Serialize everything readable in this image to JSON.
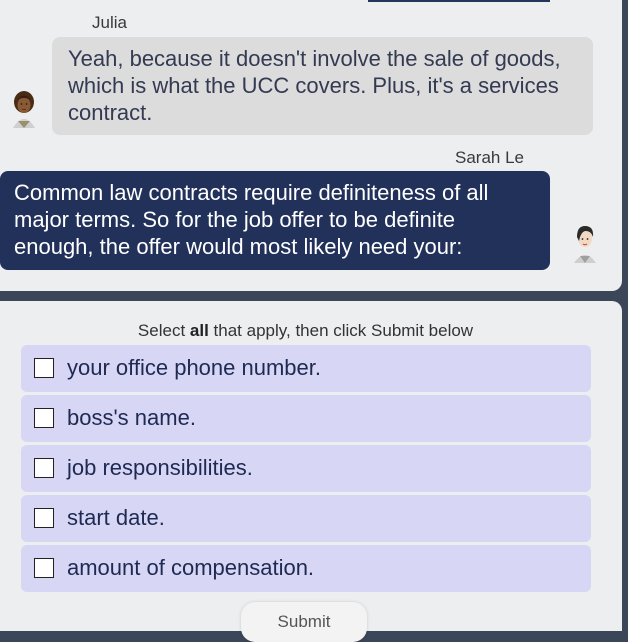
{
  "chat": {
    "messages": [
      {
        "sender": "Julia",
        "text": "Yeah, because it doesn't involve the sale of goods, which is what the UCC covers.  Plus, it's a services contract."
      },
      {
        "sender": "Sarah Le",
        "text": "Common law contracts require definiteness of all major terms. So for the job offer to be definite enough, the offer would most likely need your:"
      }
    ]
  },
  "question": {
    "instruction_prefix": "Select ",
    "instruction_bold": "all",
    "instruction_suffix": " that apply, then click Submit below",
    "options": [
      {
        "label": "your office phone number.",
        "checked": false
      },
      {
        "label": "boss's name.",
        "checked": false
      },
      {
        "label": "job responsibilities.",
        "checked": false
      },
      {
        "label": "start date.",
        "checked": false
      },
      {
        "label": "amount of compensation.",
        "checked": false
      }
    ],
    "submit_label": "Submit"
  },
  "colors": {
    "page_background": "#3b4659",
    "panel_background": "#eceef0",
    "julia_bubble": "#dcdcdc",
    "sarah_bubble": "#22315a",
    "option_background": "#d8d6f5"
  },
  "icons": {
    "julia_avatar": "female-avatar-icon",
    "sarah_avatar": "female-avatar-icon"
  }
}
